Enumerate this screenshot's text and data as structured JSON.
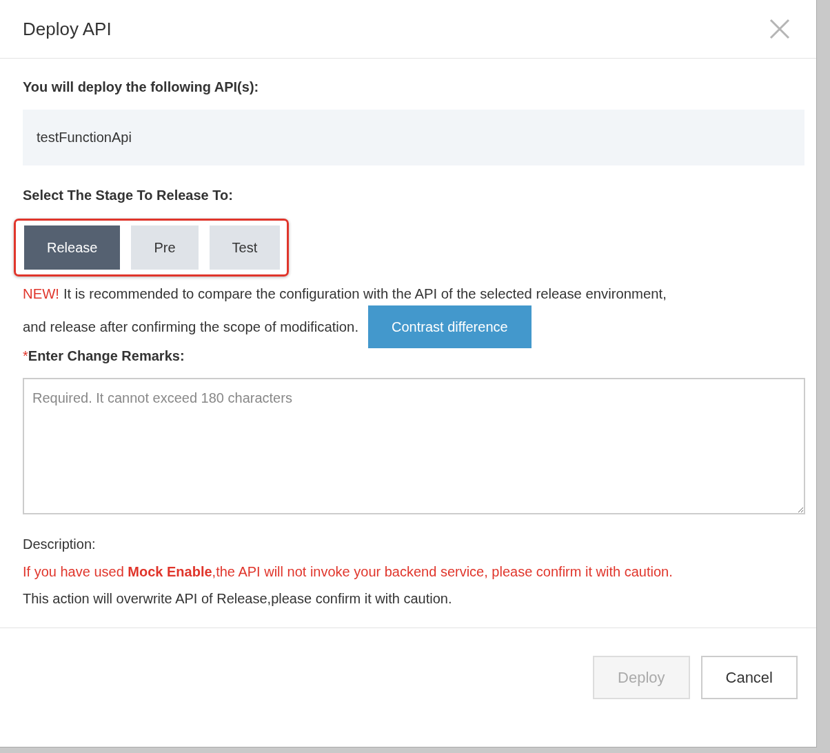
{
  "dialog": {
    "title": "Deploy API"
  },
  "api_section": {
    "label": "You will deploy the following API(s):",
    "apis": [
      "testFunctionApi"
    ]
  },
  "stage_section": {
    "label": "Select The Stage To Release To:",
    "highlighted": true,
    "stages": [
      {
        "label": "Release",
        "selected": true
      },
      {
        "label": "Pre",
        "selected": false
      },
      {
        "label": "Test",
        "selected": false
      }
    ]
  },
  "notice": {
    "badge": "NEW!",
    "lines": [
      "It is recommended to compare the configuration with the API of the selected release environment,",
      "and release after confirming the scope of modification."
    ],
    "button": "Contrast difference"
  },
  "remarks": {
    "required_mark": "*",
    "label": "Enter Change Remarks:",
    "placeholder": "Required. It cannot exceed 180 characters"
  },
  "description": {
    "label": "Description:",
    "warning": "If you have used **Mock Enable**,the API will not invoke your backend service, please confirm it with caution.",
    "note": "This action will overwrite API of Release,please confirm it with caution."
  },
  "buttons": [
    {
      "label": "Deploy",
      "disabled": true
    },
    {
      "label": "Cancel",
      "disabled": false
    }
  ]
}
